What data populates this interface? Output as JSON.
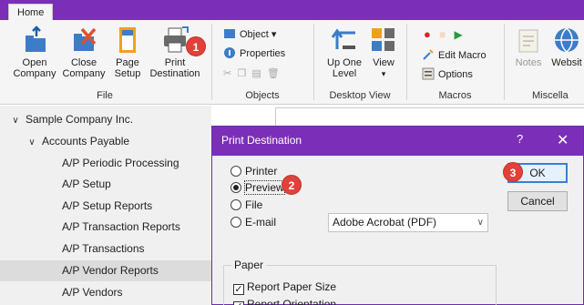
{
  "ribbon": {
    "tab_home": "Home",
    "file_group": {
      "label": "File",
      "buttons": [
        {
          "label1": "Open",
          "label2": "Company",
          "icon": "open-company-icon"
        },
        {
          "label1": "Close",
          "label2": "Company",
          "icon": "close-company-icon"
        },
        {
          "label1": "Page",
          "label2": "Setup",
          "icon": "page-setup-icon"
        },
        {
          "label1": "Print",
          "label2": "Destination",
          "icon": "printer-icon"
        }
      ]
    },
    "objects_group": {
      "label": "Objects",
      "object": "Object",
      "properties": "Properties"
    },
    "desktop_group": {
      "label": "Desktop View",
      "up_one_level_1": "Up One",
      "up_one_level_2": "Level",
      "view": "View"
    },
    "macros_group": {
      "label": "Macros",
      "edit_macro": "Edit Macro",
      "options": "Options"
    },
    "misc_group": {
      "label": "Miscella",
      "notes": "Notes",
      "website": "Websit"
    }
  },
  "badges": {
    "one": "1",
    "two": "2",
    "three": "3"
  },
  "tree": {
    "items": [
      {
        "label": "Sample Company Inc.",
        "level": 0,
        "chevron": "∨"
      },
      {
        "label": "Accounts Payable",
        "level": 1,
        "chevron": "∨"
      },
      {
        "label": "A/P Periodic Processing",
        "level": 2
      },
      {
        "label": "A/P Setup",
        "level": 2
      },
      {
        "label": "A/P Setup Reports",
        "level": 2
      },
      {
        "label": "A/P Transaction Reports",
        "level": 2
      },
      {
        "label": "A/P Transactions",
        "level": 2
      },
      {
        "label": "A/P Vendor Reports",
        "level": 2,
        "selected": true
      },
      {
        "label": "A/P Vendors",
        "level": 2
      }
    ]
  },
  "dialog": {
    "title": "Print Destination",
    "help": "?",
    "close": "✕",
    "radios": [
      "Printer",
      "Preview",
      "File",
      "E-mail"
    ],
    "selected": "Preview",
    "ok": "OK",
    "cancel": "Cancel",
    "email_select": "Adobe Acrobat (PDF)",
    "paper_label": "Paper",
    "checkboxes": [
      "Report Paper Size",
      "Report Orientation"
    ]
  },
  "colors": {
    "accent": "#7b2fb8",
    "badge": "#e0413a"
  }
}
